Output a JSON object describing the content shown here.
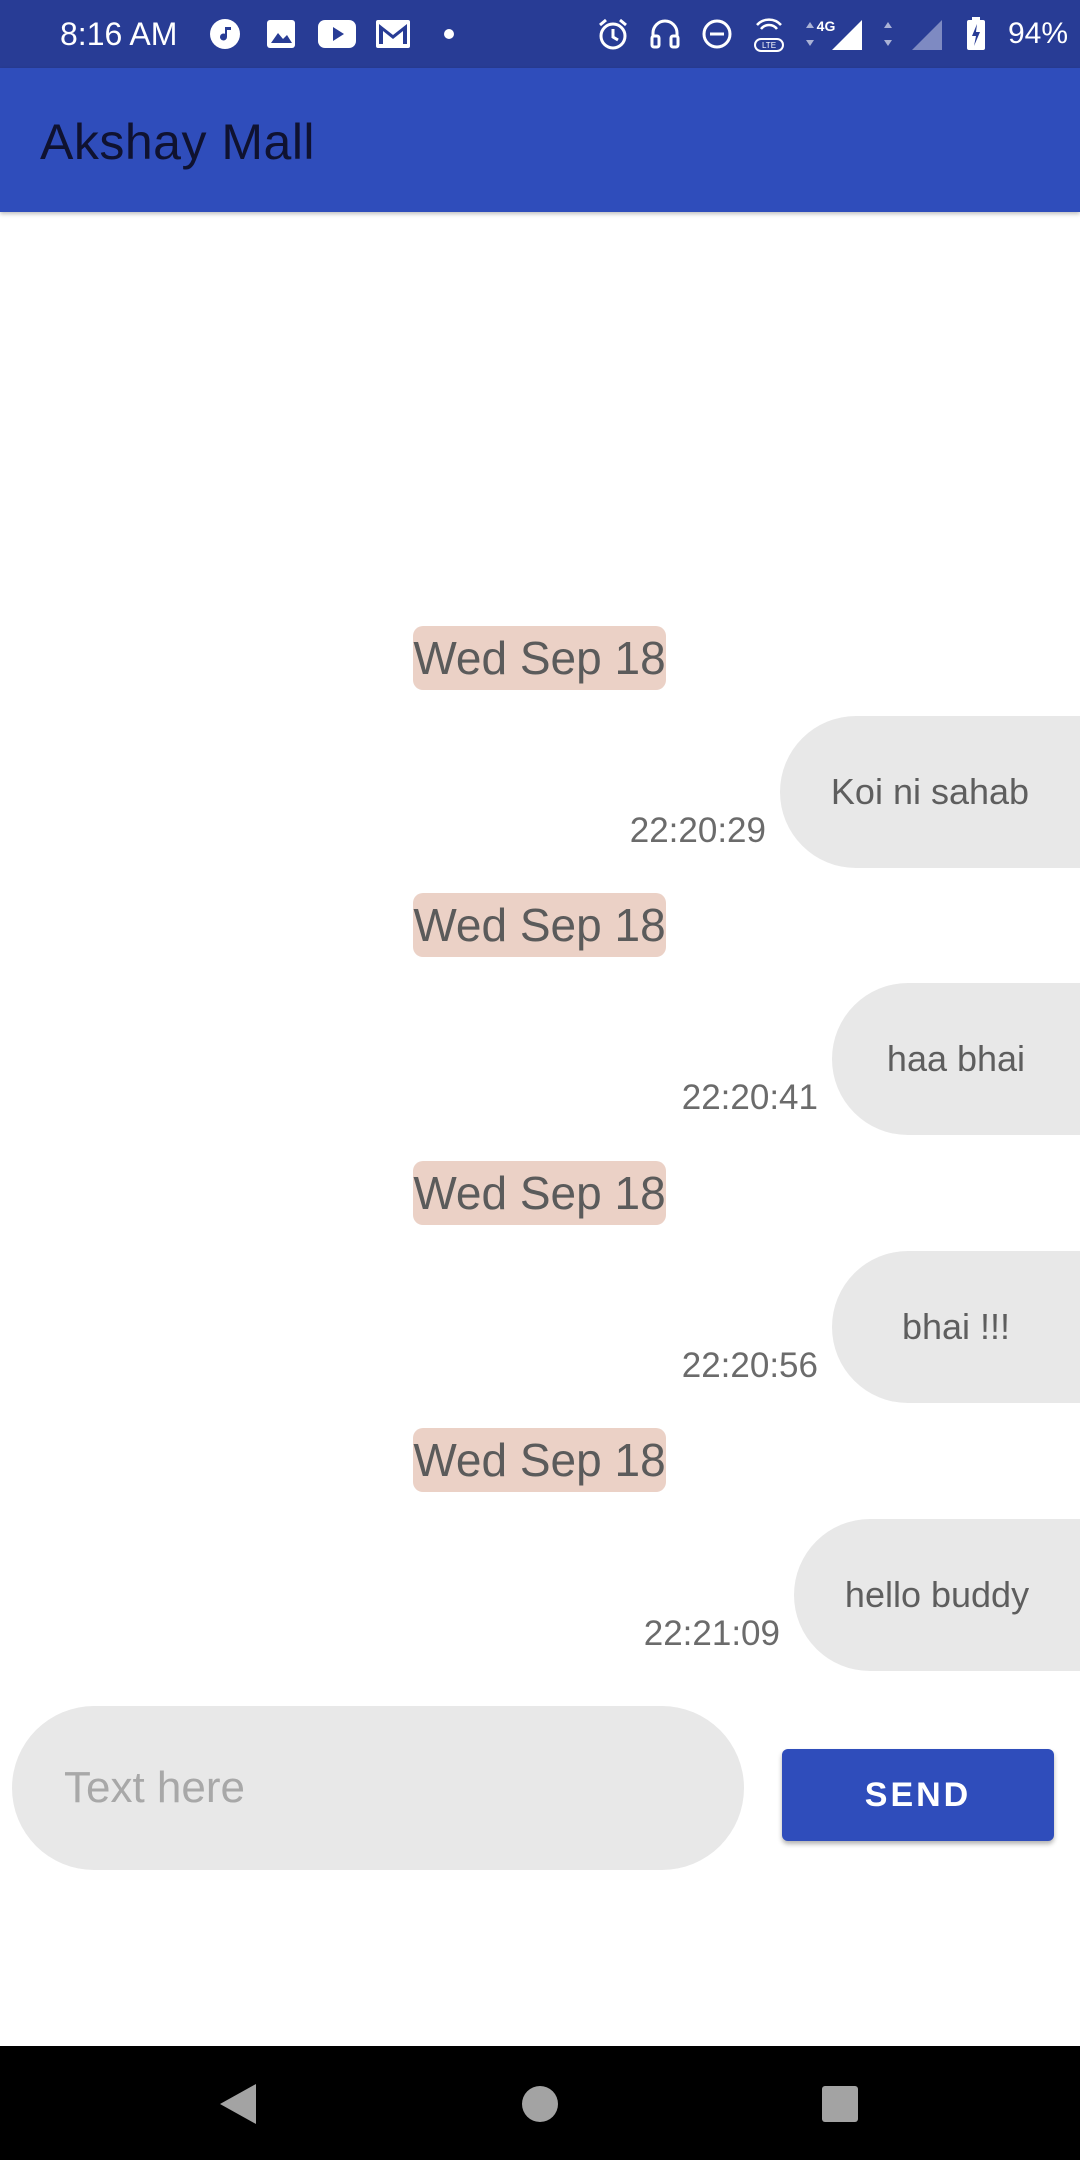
{
  "status_bar": {
    "time": "8:16 AM",
    "battery": "94%",
    "left_icons": [
      "music-note-icon",
      "image-icon",
      "youtube-icon",
      "gmail-icon",
      "dot-icon"
    ],
    "right_icons": [
      "alarm-icon",
      "headset-icon",
      "do-not-disturb-icon",
      "volte-icon",
      "signal-4g-icon",
      "signal-icon",
      "battery-charging-icon"
    ],
    "network_label": "4G"
  },
  "app_bar": {
    "title": "Akshay Mall"
  },
  "chat": {
    "messages": [
      {
        "date": "Wed Sep 18",
        "text": "Koi ni sahab",
        "time": "22:20:29"
      },
      {
        "date": "Wed Sep 18",
        "text": "haa bhai",
        "time": "22:20:41"
      },
      {
        "date": "Wed Sep 18",
        "text": "bhai !!!",
        "time": "22:20:56"
      },
      {
        "date": "Wed Sep 18",
        "text": "hello buddy",
        "time": "22:21:09"
      }
    ]
  },
  "composer": {
    "placeholder": "Text here",
    "value": "",
    "send_label": "SEND"
  },
  "nav_bar": {
    "icons": [
      "back-icon",
      "home-icon",
      "recents-icon"
    ]
  },
  "colors": {
    "status_bar": "#283c95",
    "app_bar": "#2f4dbb",
    "date_chip": "#ebd1c6",
    "bubble": "#e8e8e8",
    "send_button": "#2f4dbb"
  }
}
